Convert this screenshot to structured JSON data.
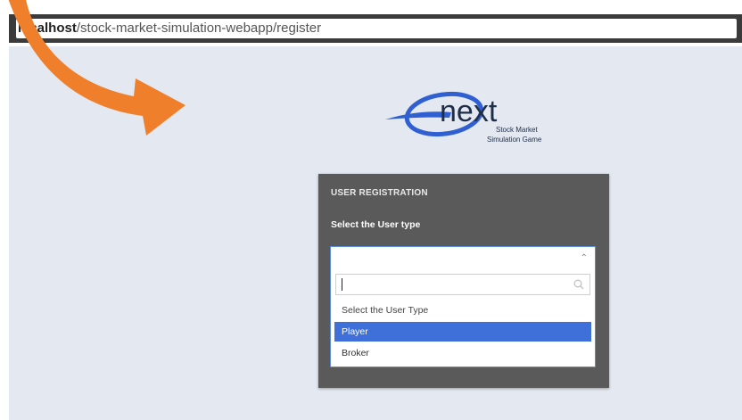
{
  "browser": {
    "url_host": "localhost",
    "url_path": "/stock-market-simulation-webapp/register"
  },
  "logo": {
    "wordmark": "next",
    "tagline_line1": "Stock Market",
    "tagline_line2": "Simulation Game"
  },
  "registration": {
    "title": "USER REGISTRATION",
    "user_type_label": "Select the User type",
    "search_value": "",
    "options": [
      "Select the User Type",
      "Player",
      "Broker"
    ],
    "highlighted_option": "Player"
  },
  "colors": {
    "arrow": "#ef7f2a",
    "logo_blue": "#2f5fd0",
    "panel": "#5a5a5a",
    "page_bg": "#e4e8f0",
    "highlight": "#3f6fd8"
  }
}
